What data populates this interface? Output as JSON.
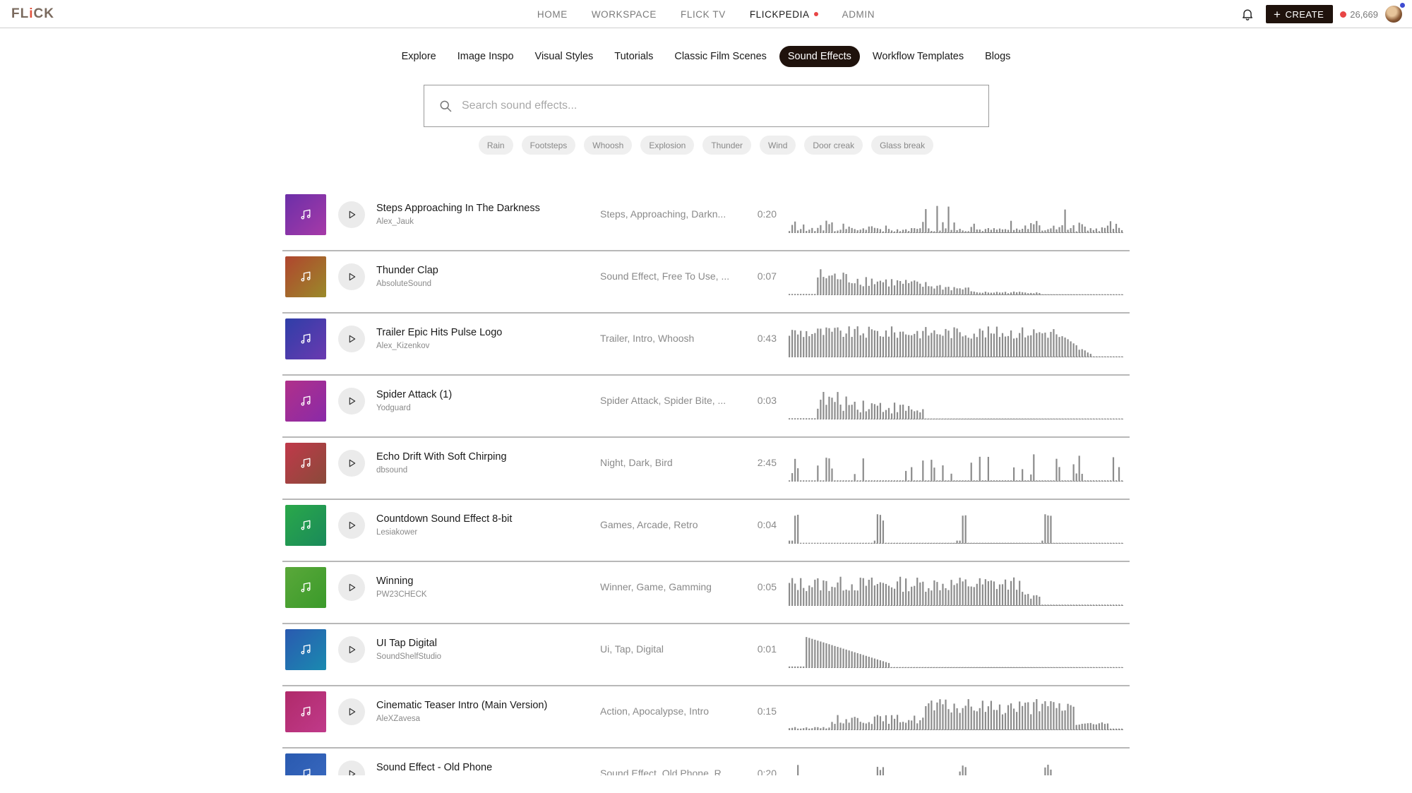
{
  "brand": {
    "logo_text_a": "FL",
    "logo_text_b": "i",
    "logo_text_c": "CK"
  },
  "nav": {
    "links": [
      "HOME",
      "WORKSPACE",
      "FLICK TV",
      "FLICKPEDIA",
      "ADMIN"
    ],
    "active": "FLICKPEDIA",
    "create_label": "CREATE",
    "credits": "26,669"
  },
  "tabs": {
    "items": [
      "Explore",
      "Image Inspo",
      "Visual Styles",
      "Tutorials",
      "Classic Film Scenes",
      "Sound Effects",
      "Workflow Templates",
      "Blogs"
    ],
    "active": "Sound Effects"
  },
  "search": {
    "placeholder": "Search sound effects..."
  },
  "chips": [
    "Rain",
    "Footsteps",
    "Whoosh",
    "Explosion",
    "Thunder",
    "Wind",
    "Door creak",
    "Glass break"
  ],
  "colors": {
    "accent_dark": "#1f120c",
    "notification_dot": "#e84545",
    "waveform": "#8c8c8c"
  },
  "sounds": [
    {
      "title": "Steps Approaching In The Darkness",
      "author": "Alex_Jauk",
      "tags": "Steps, Approaching, Darkn...",
      "duration": "0:20",
      "thumb": [
        "#6c2fa8",
        "#a63aa8"
      ],
      "wave": "sparse"
    },
    {
      "title": "Thunder Clap",
      "author": "AbsoluteSound",
      "tags": "Sound Effect, Free To Use, ...",
      "duration": "0:07",
      "thumb": [
        "#b0452e",
        "#9a8a2a"
      ],
      "wave": "thunder"
    },
    {
      "title": "Trailer Epic Hits Pulse Logo",
      "author": "Alex_Kizenkov",
      "tags": "Trailer, Intro, Whoosh",
      "duration": "0:43",
      "thumb": [
        "#2f3ea8",
        "#6a3ab0"
      ],
      "wave": "dense"
    },
    {
      "title": "Spider Attack (1)",
      "author": "Yodguard",
      "tags": "Spider Attack, Spider Bite, ...",
      "duration": "0:03",
      "thumb": [
        "#b0308a",
        "#8a2aa8"
      ],
      "wave": "spider"
    },
    {
      "title": "Echo Drift With Soft Chirping",
      "author": "dbsound",
      "tags": "Night, Dark, Bird",
      "duration": "2:45",
      "thumb": [
        "#c0394a",
        "#8a4a3a"
      ],
      "wave": "chirp"
    },
    {
      "title": "Countdown Sound Effect 8-bit",
      "author": "Lesiakower",
      "tags": "Games, Arcade, Retro",
      "duration": "0:04",
      "thumb": [
        "#2aa84a",
        "#1a8a5a"
      ],
      "wave": "countdown"
    },
    {
      "title": "Winning",
      "author": "PW23CHECK",
      "tags": "Winner, Game, Gamming",
      "duration": "0:05",
      "thumb": [
        "#5aa83a",
        "#3a9a2a"
      ],
      "wave": "winning"
    },
    {
      "title": "UI Tap Digital",
      "author": "SoundShelfStudio",
      "tags": "Ui, Tap, Digital",
      "duration": "0:01",
      "thumb": [
        "#2a5ab0",
        "#1a8ab0"
      ],
      "wave": "tap"
    },
    {
      "title": "Cinematic Teaser Intro (Main Version)",
      "author": "AleXZavesa",
      "tags": "Action, Apocalypse, Intro",
      "duration": "0:15",
      "thumb": [
        "#b02a6a",
        "#c03a8a"
      ],
      "wave": "cinematic"
    },
    {
      "title": "Sound Effect - Old Phone",
      "author": "",
      "tags": "Sound Effect, Old Phone, R...",
      "duration": "0:20",
      "thumb": [
        "#2a5ab0",
        "#3a6ac0"
      ],
      "wave": "phone"
    }
  ]
}
